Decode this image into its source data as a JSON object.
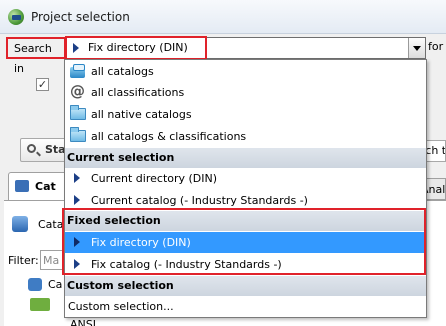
{
  "window": {
    "title": "Project selection"
  },
  "search_row": {
    "label": "Search in",
    "selected_value": "Fix directory (DIN)",
    "for_label": "for"
  },
  "background": {
    "checkbox_mark": "✓",
    "search_button_label": "Sta",
    "search_field_text": "rch te",
    "tab_label": "Cat",
    "analysis_tab_text": "Analy",
    "catalog_label": "Cata",
    "filter_label": "Filter:",
    "filter_placeholder": "Ma",
    "tree_item_1": "Ca",
    "tree_item_ansi": "ANSI"
  },
  "dropdown": {
    "items": [
      {
        "label": "all catalogs",
        "icon": "catalogs-icon"
      },
      {
        "label": "all classifications",
        "icon": "at-icon"
      },
      {
        "label": "all native catalogs",
        "icon": "folder-icon"
      },
      {
        "label": "all catalogs & classifications",
        "icon": "folder-icon"
      }
    ],
    "current_selection": {
      "header": "Current selection",
      "items": [
        "Current directory (DIN)",
        "Current catalog (- Industry Standards -)"
      ]
    },
    "fixed_selection": {
      "header": "Fixed selection",
      "items": [
        "Fix directory (DIN)",
        "Fix catalog (- Industry Standards -)"
      ]
    },
    "custom_selection": {
      "header": "Custom selection",
      "items": [
        "Custom selection..."
      ]
    }
  },
  "colors": {
    "highlight": "#3399ff",
    "annotation_red": "#e0222a",
    "header_bg": "#d6dde6"
  }
}
